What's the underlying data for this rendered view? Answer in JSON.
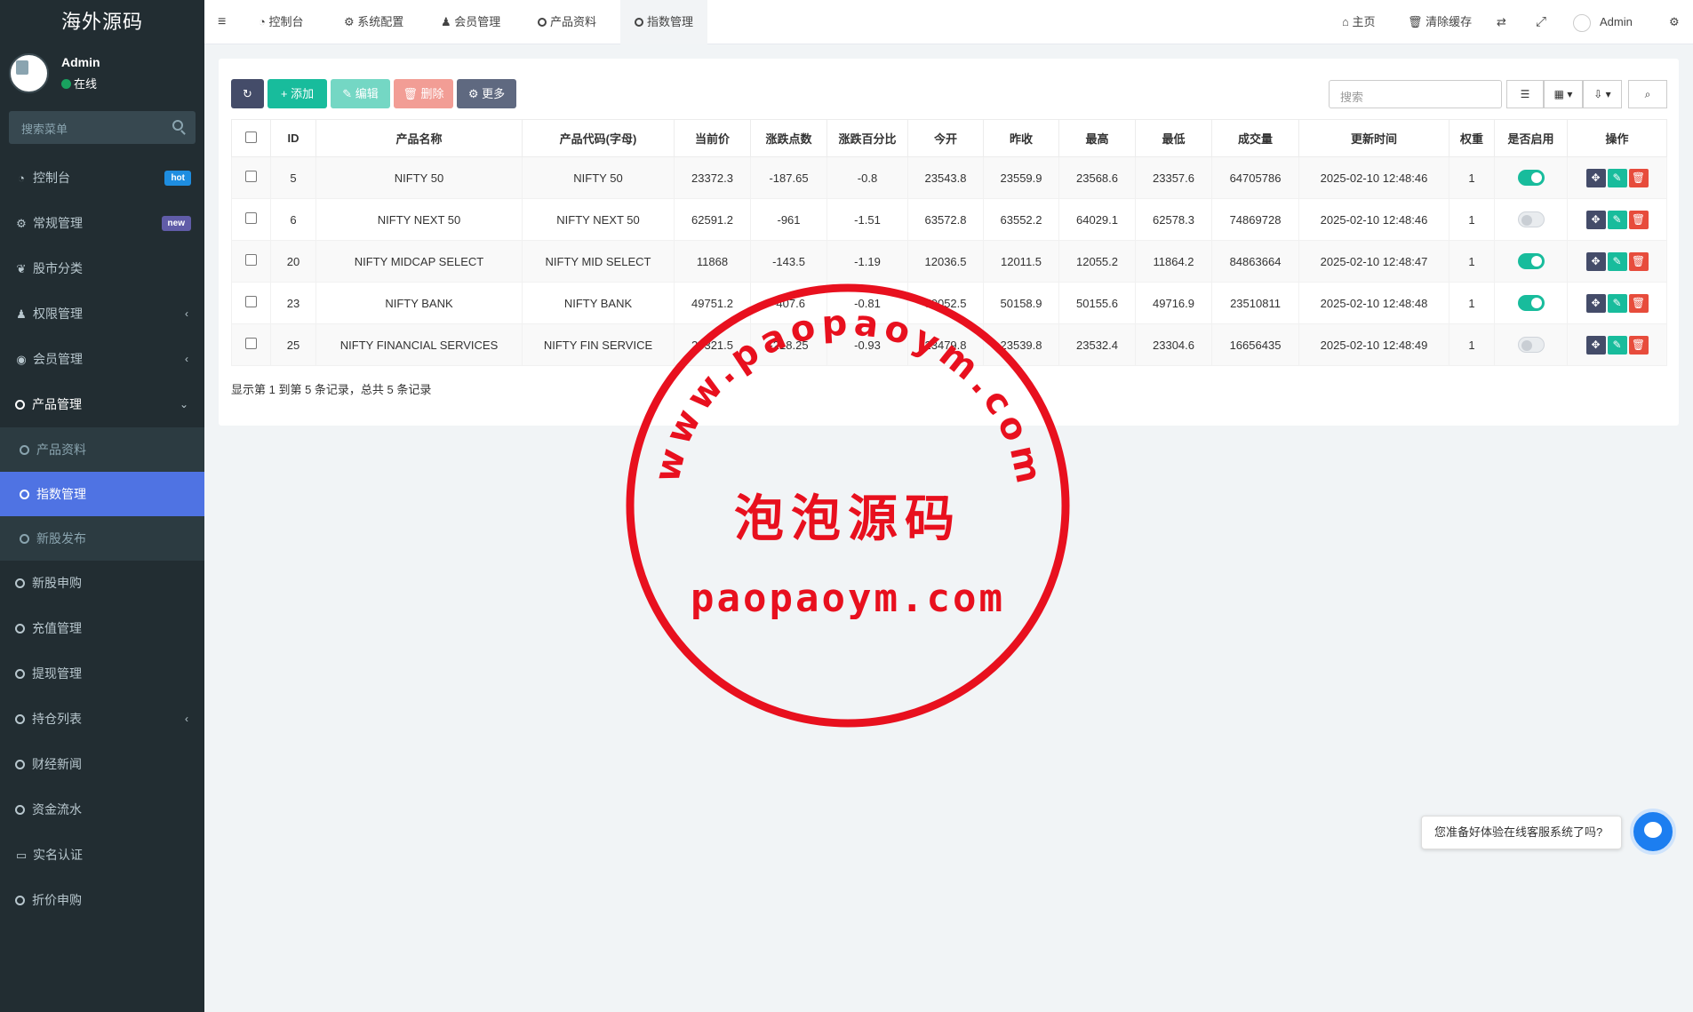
{
  "sidebar": {
    "logo": "海外源码",
    "user": {
      "name": "Admin",
      "status": "在线"
    },
    "search_placeholder": "搜索菜单",
    "items": [
      {
        "label": "控制台",
        "icon": "dashboard-icon",
        "badge": "hot"
      },
      {
        "label": "常规管理",
        "icon": "cogs-icon",
        "badge": "new"
      },
      {
        "label": "股市分类",
        "icon": "leaf-icon"
      },
      {
        "label": "权限管理",
        "icon": "group-icon"
      },
      {
        "label": "会员管理",
        "icon": "user-circle-icon"
      },
      {
        "label": "产品管理",
        "icon": "circle-icon"
      }
    ],
    "sub_items": [
      {
        "label": "产品资料"
      },
      {
        "label": "指数管理"
      },
      {
        "label": "新股发布"
      }
    ],
    "items_after": [
      {
        "label": "新股申购"
      },
      {
        "label": "充值管理"
      },
      {
        "label": "提现管理"
      },
      {
        "label": "持仓列表"
      },
      {
        "label": "财经新闻"
      },
      {
        "label": "资金流水"
      },
      {
        "label": "实名认证"
      },
      {
        "label": "折价申购"
      }
    ]
  },
  "topbar": {
    "tabs": [
      "控制台",
      "系统配置",
      "会员管理",
      "产品资料",
      "指数管理"
    ],
    "home": "主页",
    "clear_cache": "清除缓存",
    "user": "Admin"
  },
  "toolbar": {
    "add": "添加",
    "edit": "编辑",
    "delete": "删除",
    "more": "更多",
    "search_placeholder": "搜索"
  },
  "table": {
    "headers": [
      "ID",
      "产品名称",
      "产品代码(字母)",
      "当前价",
      "涨跌点数",
      "涨跌百分比",
      "今开",
      "昨收",
      "最高",
      "最低",
      "成交量",
      "更新时间",
      "权重",
      "是否启用",
      "操作"
    ],
    "rows": [
      [
        "5",
        "NIFTY 50",
        "NIFTY 50",
        "23372.3",
        "-187.65",
        "-0.8",
        "23543.8",
        "23559.9",
        "23568.6",
        "23357.6",
        "64705786",
        "2025-02-10 12:48:46",
        "1"
      ],
      [
        "6",
        "NIFTY NEXT 50",
        "NIFTY NEXT 50",
        "62591.2",
        "-961",
        "-1.51",
        "63572.8",
        "63552.2",
        "64029.1",
        "62578.3",
        "74869728",
        "2025-02-10 12:48:46",
        "1"
      ],
      [
        "20",
        "NIFTY MIDCAP SELECT",
        "NIFTY MID SELECT",
        "11868",
        "-143.5",
        "-1.19",
        "12036.5",
        "12011.5",
        "12055.2",
        "11864.2",
        "84863664",
        "2025-02-10 12:48:47",
        "1"
      ],
      [
        "23",
        "NIFTY BANK",
        "NIFTY BANK",
        "49751.2",
        "-407.6",
        "-0.81",
        "50052.5",
        "50158.9",
        "50155.6",
        "49716.9",
        "23510811",
        "2025-02-10 12:48:48",
        "1"
      ],
      [
        "25",
        "NIFTY FINANCIAL SERVICES",
        "NIFTY FIN SERVICE",
        "23321.5",
        "-218.25",
        "-0.93",
        "23479.8",
        "23539.8",
        "23532.4",
        "23304.6",
        "16656435",
        "2025-02-10 12:48:49",
        "1"
      ]
    ],
    "enabled": [
      true,
      false,
      true,
      true,
      false
    ],
    "footer": "显示第 1 到第 5 条记录，总共 5 条记录"
  },
  "watermark": {
    "url_arc": "www.paopaoym.com",
    "name": "泡泡源码",
    "domain": "paopaoym.com"
  },
  "chat": {
    "prompt": "您准备好体验在线客服系统了吗?"
  },
  "colors": {
    "sidebar_bg": "#222d32",
    "accent": "#4f73e3",
    "success": "#18bc9c",
    "danger": "#e74c3c",
    "stamp_red": "#e8101e"
  }
}
